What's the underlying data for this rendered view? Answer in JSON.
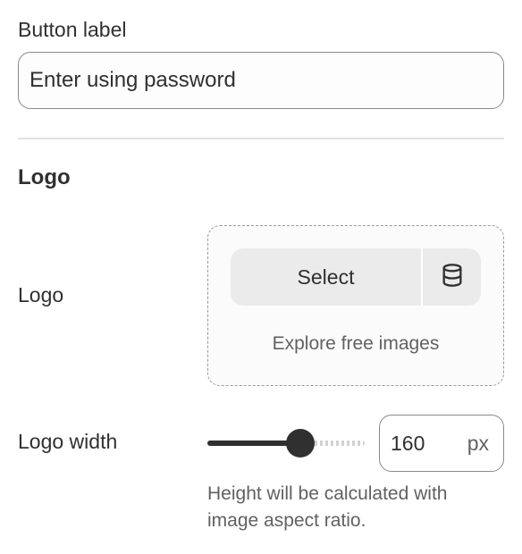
{
  "button_label": {
    "label": "Button label",
    "value": "Enter using password"
  },
  "logo_section": {
    "heading": "Logo",
    "logo_label": "Logo",
    "select_label": "Select",
    "library_icon": "database-icon",
    "explore_label": "Explore free images"
  },
  "logo_width": {
    "label": "Logo width",
    "value": "160",
    "unit": "px",
    "slider_fraction": 0.59,
    "help": "Height will be calculated with image aspect ratio."
  }
}
